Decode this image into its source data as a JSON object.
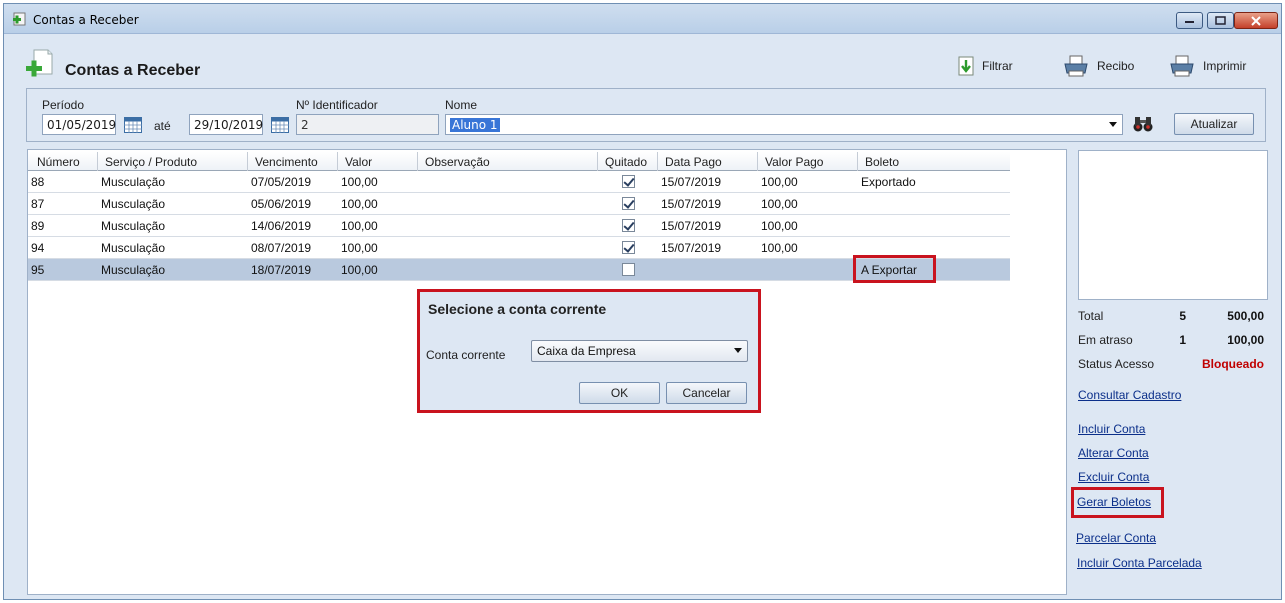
{
  "window": {
    "title": "Contas a Receber"
  },
  "header": {
    "title": "Contas a Receber"
  },
  "toolbar": {
    "filtrar": "Filtrar",
    "recibo": "Recibo",
    "imprimir": "Imprimir"
  },
  "filters": {
    "periodo_label": "Período",
    "data_inicio": "01/05/2019",
    "ate_label": "até",
    "data_fim": "29/10/2019",
    "identificador_label": "Nº Identificador",
    "identificador": "2",
    "nome_label": "Nome",
    "nome": "Aluno 1",
    "atualizar": "Atualizar"
  },
  "grid": {
    "columns": [
      "Número",
      "Serviço / Produto",
      "Vencimento",
      "Valor",
      "Observação",
      "Quitado",
      "Data Pago",
      "Valor Pago",
      "Boleto"
    ],
    "rows": [
      {
        "numero": "88",
        "servico": "Musculação",
        "vencimento": "07/05/2019",
        "valor": "100,00",
        "observacao": "",
        "quitado": true,
        "data_pago": "15/07/2019",
        "valor_pago": "100,00",
        "boleto": "Exportado"
      },
      {
        "numero": "87",
        "servico": "Musculação",
        "vencimento": "05/06/2019",
        "valor": "100,00",
        "observacao": "",
        "quitado": true,
        "data_pago": "15/07/2019",
        "valor_pago": "100,00",
        "boleto": ""
      },
      {
        "numero": "89",
        "servico": "Musculação",
        "vencimento": "14/06/2019",
        "valor": "100,00",
        "observacao": "",
        "quitado": true,
        "data_pago": "15/07/2019",
        "valor_pago": "100,00",
        "boleto": ""
      },
      {
        "numero": "94",
        "servico": "Musculação",
        "vencimento": "08/07/2019",
        "valor": "100,00",
        "observacao": "",
        "quitado": true,
        "data_pago": "15/07/2019",
        "valor_pago": "100,00",
        "boleto": ""
      },
      {
        "numero": "95",
        "servico": "Musculação",
        "vencimento": "18/07/2019",
        "valor": "100,00",
        "observacao": "",
        "quitado": false,
        "data_pago": "",
        "valor_pago": "",
        "boleto": "A Exportar"
      }
    ]
  },
  "dialog": {
    "title": "Selecione a conta corrente",
    "label": "Conta corrente",
    "selected": "Caixa da Empresa",
    "ok": "OK",
    "cancelar": "Cancelar"
  },
  "summary": {
    "total_label": "Total",
    "total_count": "5",
    "total_value": "500,00",
    "atraso_label": "Em atraso",
    "atraso_count": "1",
    "atraso_value": "100,00",
    "status_label": "Status Acesso",
    "status_value": "Bloqueado",
    "status_color": "#c00000"
  },
  "links": {
    "consultar": "Consultar Cadastro",
    "incluir": "Incluir Conta",
    "alterar": "Alterar Conta",
    "excluir": "Excluir Conta",
    "gerar": "Gerar Boletos",
    "parcelar": "Parcelar Conta",
    "incluir_parcelada": "Incluir Conta Parcelada"
  },
  "highlight_color": "#c9131e"
}
